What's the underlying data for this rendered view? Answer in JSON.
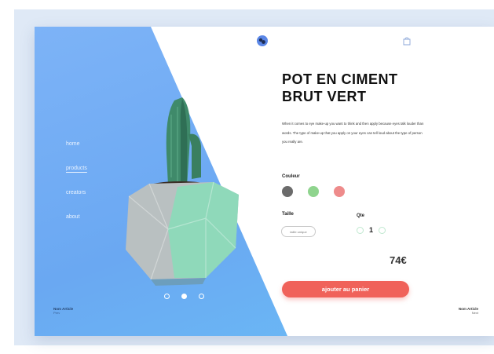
{
  "nav": {
    "items": [
      {
        "label": "home"
      },
      {
        "label": "products",
        "active": true
      },
      {
        "label": "creators"
      },
      {
        "label": "about"
      }
    ]
  },
  "product": {
    "title_line1": "POT EN CIMENT",
    "title_line2": "BRUT VERT",
    "description": "When it comes to eye make-up you want to think and then apply because eyes talk louder than words. The type of make-up that you apply on your eyes can tell loud about the type of person you really are.",
    "color_label": "Couleur",
    "colors": [
      "#6b6b6b",
      "#8fd48e",
      "#ee8b8b"
    ],
    "size_label": "Taille",
    "size_value": "taille unique",
    "qty_label": "Qte",
    "qty_value": "1",
    "price": "74€",
    "add_to_cart_label": "ajouter au panier"
  },
  "carousel": {
    "count": 3,
    "active_index": 1
  },
  "footer": {
    "prev_title": "Nom Article",
    "prev_sub": "Prev",
    "next_title": "Nom Article",
    "next_sub": "Next"
  },
  "icons": {
    "logo": "logo-icon",
    "cart": "shopping-bag-icon",
    "qty_minus": "minus-icon",
    "qty_plus": "plus-icon"
  },
  "theme": {
    "accent": "#f0625a",
    "panel_blue": "#6aa8f2",
    "page_bg": "#dfe9f6"
  }
}
